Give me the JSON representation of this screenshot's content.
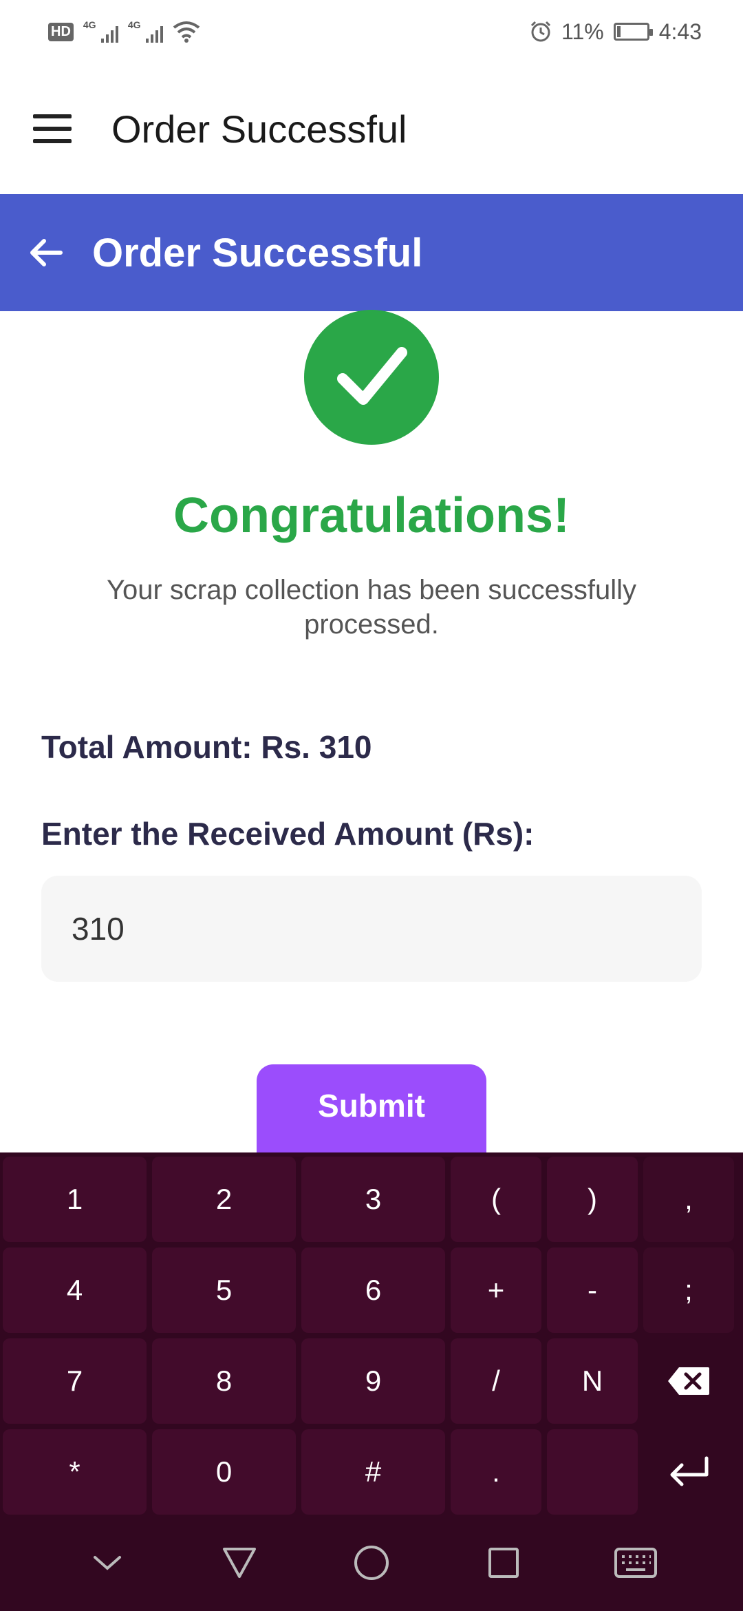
{
  "status_bar": {
    "hd": "HD",
    "sim1_network": "4G",
    "sim2_network": "4G",
    "battery_percent": "11%",
    "time": "4:43"
  },
  "app_bar": {
    "title": "Order Successful"
  },
  "header": {
    "title": "Order Successful"
  },
  "success": {
    "heading": "Congratulations!",
    "message": "Your scrap collection has been successfully processed."
  },
  "order": {
    "total_label": "Total Amount: Rs. 310",
    "received_label": "Enter the Received Amount (Rs):",
    "received_value": "310",
    "submit_label": "Submit"
  },
  "keyboard": {
    "rows": [
      [
        "1",
        "2",
        "3",
        "(",
        ")",
        ","
      ],
      [
        "4",
        "5",
        "6",
        "+",
        "-",
        ";"
      ],
      [
        "7",
        "8",
        "9",
        "/",
        "N",
        "backspace"
      ],
      [
        "*",
        "0",
        "#",
        ".",
        "",
        "enter"
      ]
    ]
  },
  "colors": {
    "header_blue": "#4a5ccc",
    "success_green": "#2aa748",
    "submit_purple": "#9b4dfc",
    "keyboard_bg": "#320720",
    "key_bg": "#420b2b",
    "label_text": "#2c2a4a"
  },
  "icons": {
    "menu": "hamburger-menu-icon",
    "back": "back-arrow-icon",
    "success": "checkmark-icon",
    "alarm": "alarm-clock-icon",
    "wifi": "wifi-icon",
    "battery": "battery-charging-icon",
    "backspace": "backspace-icon",
    "enter": "enter-icon",
    "nav_down": "chevron-down-icon",
    "nav_back": "triangle-back-icon",
    "nav_home": "circle-home-icon",
    "nav_recents": "square-recents-icon",
    "nav_keyboard": "keyboard-icon"
  }
}
